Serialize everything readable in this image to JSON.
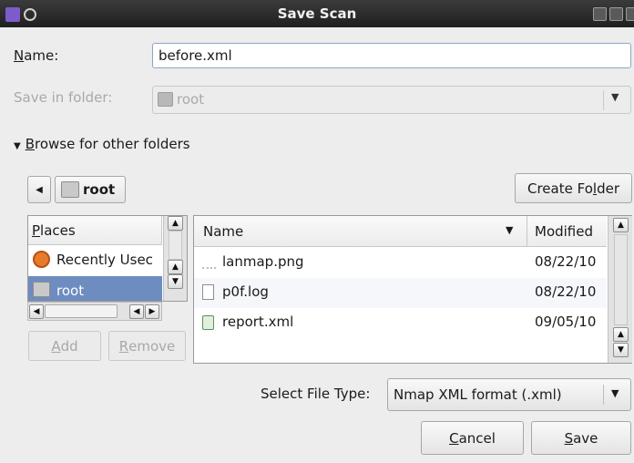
{
  "window": {
    "title": "Save Scan"
  },
  "form": {
    "name_label_u": "N",
    "name_label_rest": "ame:",
    "name_value": "before.xml",
    "folder_label": "Save in folder:",
    "folder_value": "root"
  },
  "browse": {
    "toggle_label": "Browse for other folders",
    "toggle_u": "B",
    "toggle_rest": "rowse for other folders"
  },
  "path_bar": {
    "current": "root"
  },
  "buttons": {
    "create_folder_a": "Create Fo",
    "create_folder_u": "l",
    "create_folder_b": "der",
    "add_u": "A",
    "add_rest": "dd",
    "remove_u": "R",
    "remove_rest": "emove",
    "cancel_u": "C",
    "cancel_rest": "ancel",
    "save_u": "S",
    "save_rest": "ave"
  },
  "places": {
    "header_u": "P",
    "header_rest": "laces",
    "items": [
      {
        "label": "Recently Usec",
        "icon": "recent-icon"
      },
      {
        "label": "root",
        "icon": "home-folder-icon",
        "selected": true
      }
    ]
  },
  "files": {
    "columns": {
      "name": "Name",
      "modified": "Modified"
    },
    "rows": [
      {
        "name": "lanmap.png",
        "modified": "08/22/10",
        "icon": "image-file-icon"
      },
      {
        "name": "p0f.log",
        "modified": "08/22/10",
        "icon": "text-file-icon"
      },
      {
        "name": "report.xml",
        "modified": "09/05/10",
        "icon": "xml-file-icon"
      }
    ]
  },
  "file_type": {
    "label": "Select File Type:",
    "value": "Nmap XML format (.xml)"
  },
  "colors": {
    "selection": "#6d8cc0",
    "titlebar": "#2a2a2a",
    "accent_icon": "#7b5cc9"
  }
}
